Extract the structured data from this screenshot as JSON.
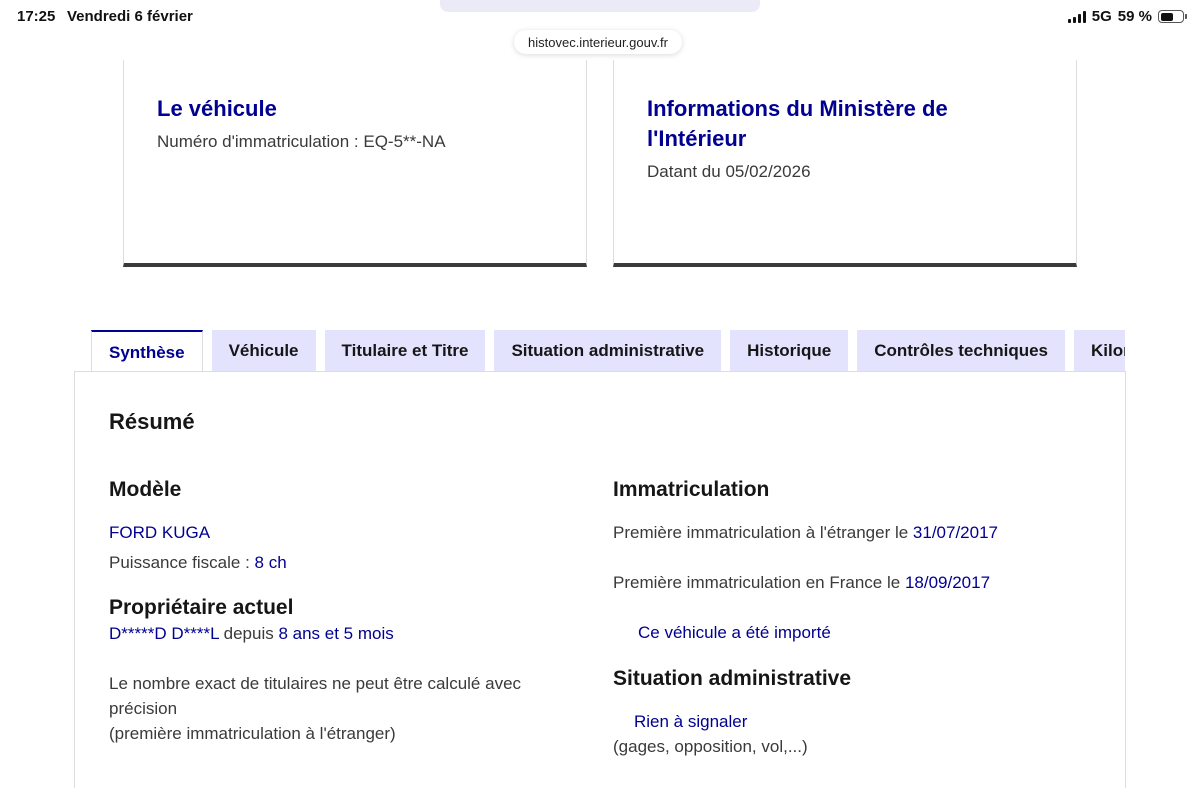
{
  "status_bar": {
    "time": "17:25",
    "date": "Vendredi 6 février",
    "network": "5G",
    "battery": "59 %",
    "battery_level": 0.59
  },
  "browser": {
    "url": "histovec.interieur.gouv.fr"
  },
  "cards": {
    "vehicle": {
      "title": "Le véhicule",
      "plate_text": "Numéro d'immatriculation : EQ-5**-NA"
    },
    "ministry": {
      "title": "Informations du Ministère de l'Intérieur",
      "date_text": "Datant du 05/02/2026"
    }
  },
  "tabs": [
    {
      "label": "Synthèse",
      "active": true
    },
    {
      "label": "Véhicule"
    },
    {
      "label": "Titulaire et Titre"
    },
    {
      "label": "Situation administrative"
    },
    {
      "label": "Historique"
    },
    {
      "label": "Contrôles techniques"
    },
    {
      "label": "Kilométrage"
    }
  ],
  "summary": {
    "heading": "Résumé",
    "model": {
      "heading": "Modèle",
      "name": "FORD KUGA",
      "power_label": "Puissance fiscale : ",
      "power_value": "8 ch"
    },
    "owner": {
      "heading": "Propriétaire actuel",
      "name": "D*****D D****L",
      "since_label": " depuis ",
      "duration": "8 ans et 5 mois",
      "note_line1": "Le nombre exact de titulaires ne peut être calculé avec précision",
      "note_line2": "(première immatriculation à l'étranger)"
    },
    "registration": {
      "heading": "Immatriculation",
      "foreign_label": "Première immatriculation à l'étranger le ",
      "foreign_date": "31/07/2017",
      "france_label": "Première immatriculation en France le ",
      "france_date": "18/09/2017",
      "imported": "Ce véhicule a été importé"
    },
    "admin": {
      "heading": "Situation administrative",
      "status": "Rien à signaler",
      "detail": "(gages, opposition, vol,...)"
    }
  },
  "colors": {
    "primary": "#000091",
    "tab_bg": "#e3e3fd",
    "text": "#3a3a3a"
  }
}
